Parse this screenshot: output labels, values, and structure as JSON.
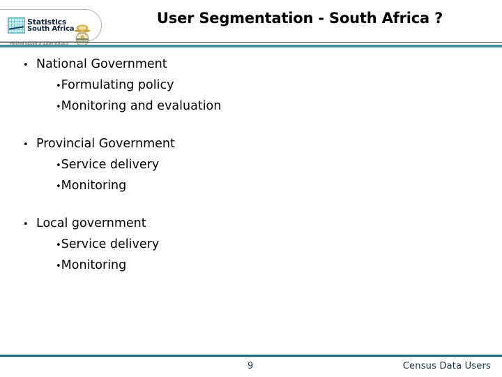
{
  "slide": {
    "title": "User Segmentation - South Africa ?",
    "page_number": "9",
    "footer_note": "Census Data Users",
    "colors": {
      "header_rule": "#3d8d97",
      "footer_rule": "#1e6d80",
      "logo_text": "#10243d",
      "body_text": "#000000"
    }
  },
  "logo": {
    "name_line_1": "Statistics",
    "name_line_2": "South Africa",
    "tagline": "Preferred supplier of quality statistics",
    "grid_icon_name": "statistics-grid-icon",
    "emblem_name": "south-africa-coat-of-arms"
  },
  "content": {
    "groups": [
      {
        "heading": "National Government",
        "bullet_glyph": "•",
        "sub_items": [
          {
            "glyph": "•",
            "label": "Formulating policy"
          },
          {
            "glyph": "•",
            "label": "Monitoring and evaluation"
          }
        ]
      },
      {
        "heading": "Provincial Government",
        "bullet_glyph": "•",
        "sub_items": [
          {
            "glyph": "•",
            "label": "Service delivery"
          },
          {
            "glyph": "•",
            "label": "Monitoring"
          }
        ]
      },
      {
        "heading": "Local government",
        "bullet_glyph": "•",
        "sub_items": [
          {
            "glyph": "•",
            "label": "Service delivery"
          },
          {
            "glyph": "•",
            "label": "Monitoring"
          }
        ]
      }
    ]
  }
}
